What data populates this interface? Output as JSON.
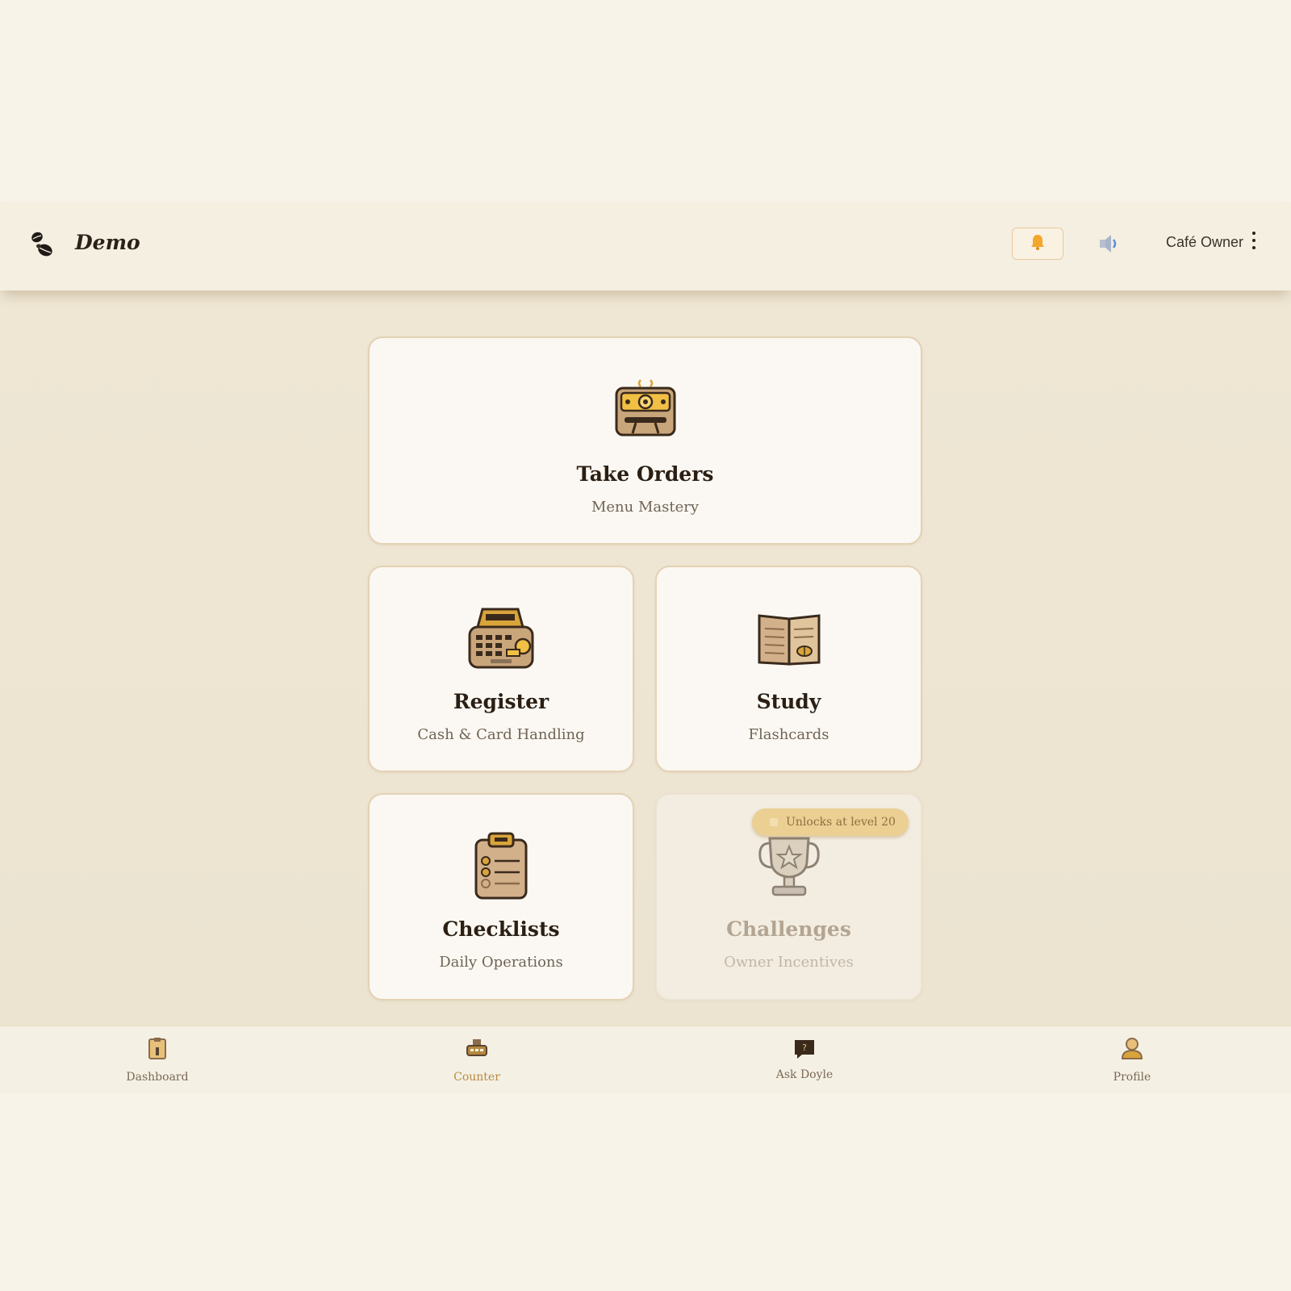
{
  "header": {
    "brand": "Demo",
    "user_label": "Café Owner",
    "icons": {
      "logo": "coffee-beans-icon",
      "notifications": "bell-icon",
      "sound": "speaker-icon",
      "more": "kebab-menu-icon"
    }
  },
  "cards": {
    "take_orders": {
      "title": "Take Orders",
      "subtitle": "Menu Mastery",
      "icon": "order-terminal-icon"
    },
    "register": {
      "title": "Register",
      "subtitle": "Cash & Card Handling",
      "icon": "cash-register-icon"
    },
    "study": {
      "title": "Study",
      "subtitle": "Flashcards",
      "icon": "open-book-icon"
    },
    "checklists": {
      "title": "Checklists",
      "subtitle": "Daily Operations",
      "icon": "clipboard-checklist-icon"
    },
    "challenges": {
      "title": "Challenges",
      "subtitle": "Owner Incentives",
      "icon": "trophy-icon",
      "badge": "Unlocks at level 20",
      "locked": true
    }
  },
  "bottom_nav": {
    "items": [
      {
        "label": "Dashboard",
        "icon": "dashboard-icon"
      },
      {
        "label": "Counter",
        "icon": "counter-icon",
        "active": true
      },
      {
        "label": "Ask Doyle",
        "icon": "chat-icon"
      },
      {
        "label": "Profile",
        "icon": "profile-icon"
      }
    ]
  },
  "colors": {
    "background": "#f7f3e9",
    "content_bg": "#efe6d4",
    "card_bg": "#fbf8f3",
    "card_border": "#e4d2b4",
    "accent": "#d9a43a",
    "active_nav": "#b58a3e",
    "text_dark": "#2b1f14"
  }
}
